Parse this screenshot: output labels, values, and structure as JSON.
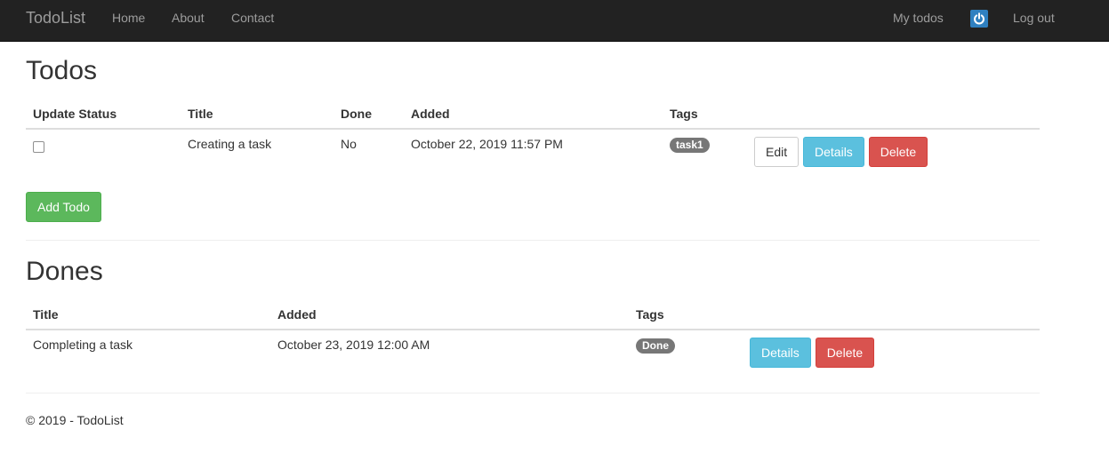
{
  "navbar": {
    "brand": "TodoList",
    "links": {
      "home": "Home",
      "about": "About",
      "contact": "Contact"
    },
    "my_todos": "My todos",
    "power_icon": "power-icon",
    "log_out": "Log out"
  },
  "todos": {
    "title": "Todos",
    "headers": {
      "update_status": "Update Status",
      "title": "Title",
      "done": "Done",
      "added": "Added",
      "tags": "Tags"
    },
    "rows": [
      {
        "title": "Creating a task",
        "done": "No",
        "added": "October 22, 2019 11:57 PM",
        "tag": "task1",
        "edit": "Edit",
        "details": "Details",
        "delete": "Delete"
      }
    ],
    "add_button": "Add Todo"
  },
  "dones": {
    "title": "Dones",
    "headers": {
      "title": "Title",
      "added": "Added",
      "tags": "Tags"
    },
    "rows": [
      {
        "title": "Completing a task",
        "added": "October 23, 2019 12:00 AM",
        "tag": "Done",
        "details": "Details",
        "delete": "Delete"
      }
    ]
  },
  "footer": {
    "text": "© 2019 - TodoList"
  },
  "colors": {
    "navbar_bg": "#222222",
    "info": "#5bc0de",
    "danger": "#d9534f",
    "success": "#5cb85c",
    "label": "#777777",
    "power_icon_bg": "#2f80c0"
  }
}
